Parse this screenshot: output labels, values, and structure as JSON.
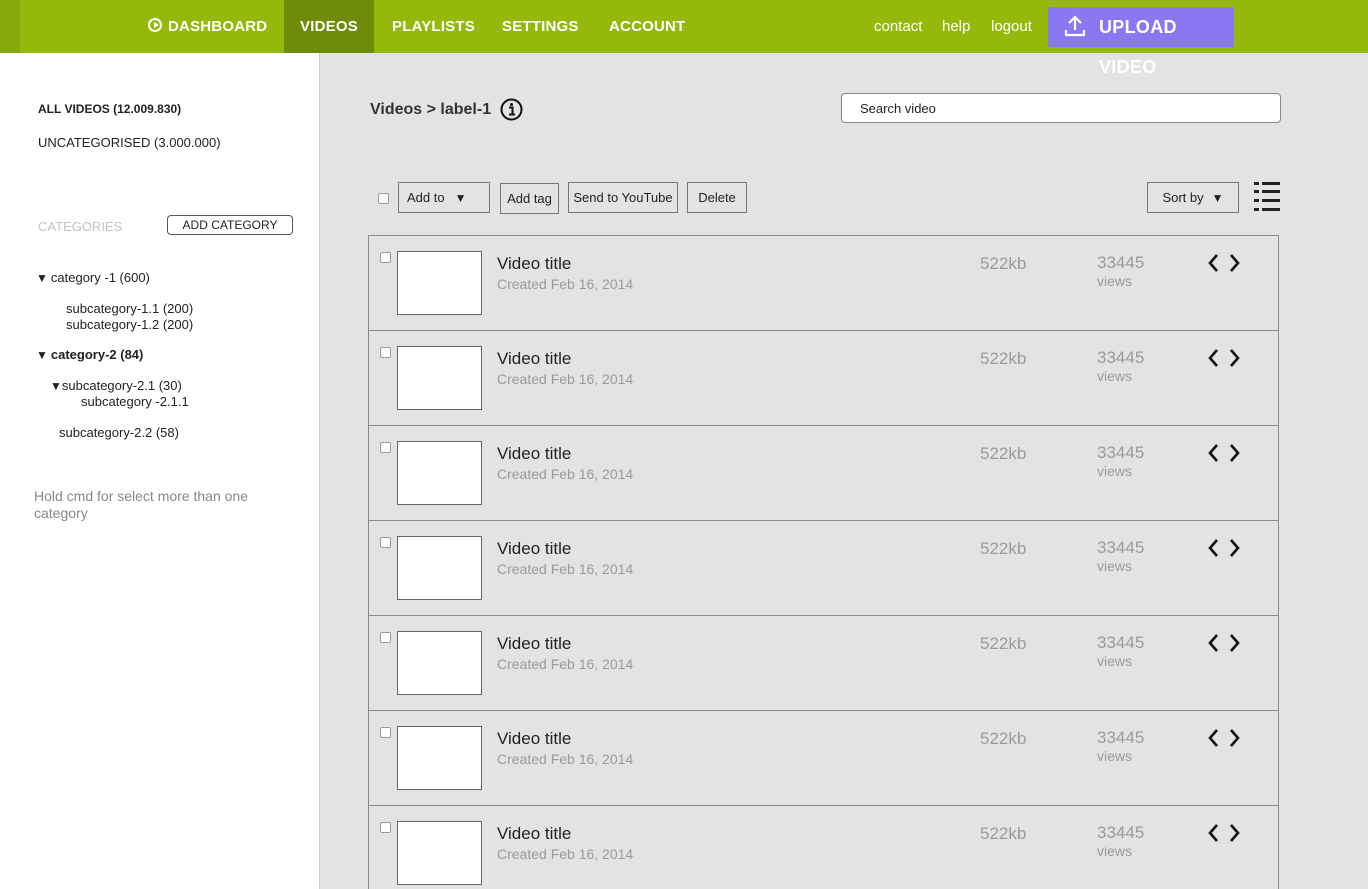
{
  "nav": {
    "dashboard": "DASHBOARD",
    "videos": "VIDEOS",
    "playlists": "PLAYLISTS",
    "settings": "SETTINGS",
    "account": "ACCOUNT",
    "contact": "contact",
    "help": "help",
    "logout": "logout",
    "upload": "UPLOAD VIDEO",
    "icons": {
      "dashboard": "play-circle-icon",
      "upload": "upload-arrow-icon"
    },
    "colors": {
      "bar": "#95b90b",
      "active": "#6e8c09",
      "upload": "#8a78f2"
    }
  },
  "sidebar": {
    "all_videos": "ALL VIDEOS (12.009.830)",
    "uncategorised": "UNCATEGORISED (3.000.000)",
    "categories_header": "CATEGORIES",
    "add_category": "ADD CATEGORY",
    "tree": {
      "cat1": "category -1 (600)",
      "sub11": "subcategory-1.1 (200)",
      "sub12": "subcategory-1.2 (200)",
      "cat2": "category-2 (84)",
      "sub21": "subcategory-2.1 (30)",
      "sub211": "subcategory -2.1.1",
      "sub22": "subcategory-2.2 (58)"
    },
    "hint": "Hold cmd for select more than one category"
  },
  "main": {
    "breadcrumb": "Videos > label-1",
    "search_placeholder": "Search video",
    "toolbar": {
      "add_to": "Add to",
      "add_tag": "Add tag",
      "send_youtube": "Send to YouTube",
      "delete": "Delete",
      "sort_by": "Sort by"
    },
    "videos": [
      {
        "title": "Video title",
        "created": "Created Feb 16, 2014",
        "size": "522kb",
        "views": "33445",
        "views_label": "views"
      },
      {
        "title": "Video title",
        "created": "Created Feb 16, 2014",
        "size": "522kb",
        "views": "33445",
        "views_label": "views"
      },
      {
        "title": "Video title",
        "created": "Created Feb 16, 2014",
        "size": "522kb",
        "views": "33445",
        "views_label": "views"
      },
      {
        "title": "Video title",
        "created": "Created Feb 16, 2014",
        "size": "522kb",
        "views": "33445",
        "views_label": "views"
      },
      {
        "title": "Video title",
        "created": "Created Feb 16, 2014",
        "size": "522kb",
        "views": "33445",
        "views_label": "views"
      },
      {
        "title": "Video title",
        "created": "Created Feb 16, 2014",
        "size": "522kb",
        "views": "33445",
        "views_label": "views"
      },
      {
        "title": "Video title",
        "created": "Created Feb 16, 2014",
        "size": "522kb",
        "views": "33445",
        "views_label": "views"
      }
    ]
  }
}
